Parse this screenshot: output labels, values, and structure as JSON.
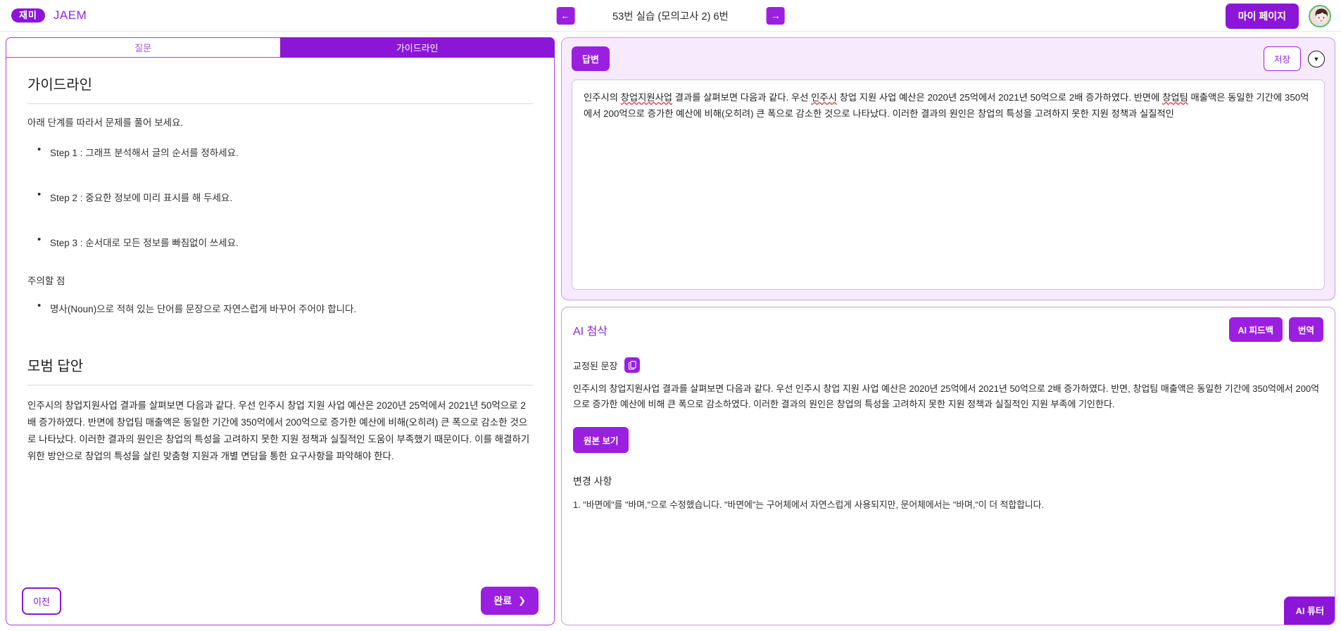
{
  "topbar": {
    "logo_text": "재미",
    "brand": "JAEM",
    "prev_icon": "arrow-left-icon",
    "next_icon": "arrow-right-icon",
    "title": "53번 실습 (모의고사 2) 6번",
    "mypage_label": "마이 페이지"
  },
  "tabs": [
    {
      "label": "질문",
      "active": false
    },
    {
      "label": "가이드라인",
      "active": true
    }
  ],
  "guideline": {
    "heading": "가이드라인",
    "intro": "아래 단계를 따라서 문제를 풀어 보세요.",
    "steps": [
      "Step 1 : 그래프 분석해서 글의 순서를 정하세요.",
      "Step 2 : 중요한 정보에 미리 표시를 해 두세요.",
      "Step 3 : 순서대로 모든 정보를 빠짐없이 쓰세요."
    ],
    "caution_title": "주의할 점",
    "caution_items": [
      "명사(Noun)으로 적혀 있는 단어를 문장으로 자연스럽게 바꾸어 주어야 합니다."
    ],
    "model_answer_heading": "모범 답안",
    "model_answer_text": "인주시의 창업지원사업 결과를 살펴보면 다음과 같다. 우선 인주시 창업 지원 사업 예산은 2020년 25억에서 2021년 50억으로 2배 증가하였다. 반면에 창업팀 매출액은 동일한 기간에 350억에서 200억으로 증가한 예산에 비해(오히려) 큰 폭으로 감소한 것으로 나타났다. 이러한 결과의 원인은 창업의 특성을 고려하지 못한 지원 정책과 실질적인 도움이 부족했기 때문이다. 이를 해결하기 위한 방안으로 창업의 특성을 살린 맞춤형 지원과 개별 면담을 통한 요구사항을 파악해야 한다."
  },
  "footer": {
    "prev_label": "이전",
    "done_label": "완료",
    "done_chevron": "chevron-right-icon"
  },
  "answer": {
    "badge_label": "답변",
    "save_label": "저장",
    "collapse_icon": "chevron-down-icon",
    "text_part1": "인주시의 ",
    "text_sp1": "창업지원사업",
    "text_part2": " 결과를 살펴보면 다음과 같다. 우선 ",
    "text_sp2": "인주시",
    "text_part3": " 창업 지원 사업 예산은 2020년 25억에서 2021년 50억으로 2배 증가하였다. 반면에 ",
    "text_sp3": "창업팀",
    "text_part4": " 매출액은 동일한 기간에 350억에서 200억으로 증가한 예산에 비해(오히려) 큰 폭으로 감소한 것으로 나타났다. 이러한 결과의 원인은 창업의 특성을 고려하지 못한 지원 정책과 실질적인"
  },
  "ai": {
    "title": "AI 첨삭",
    "feedback_label": "AI 피드백",
    "translate_label": "번역",
    "corrected_label": "교정된 문장",
    "copy_icon": "copy-icon",
    "corrected_text": "인주시의 창업지원사업 결과를 살펴보면 다음과 같다. 우선 인주시 창업 지원 사업 예산은 2020년 25억에서 2021년 50억으로 2배 증가하였다. 반면, 창업팀 매출액은 동일한 기간에 350억에서 200억으로 증가한 예산에 비해 큰 폭으로 감소하였다. 이러한 결과의 원인은 창업의 특성을 고려하지 못한 지원 정책과 실질적인 지원 부족에 기인한다.",
    "original_label": "원본 보기",
    "changes_title": "변경 사항",
    "changes": [
      "1. \"바면에\"를 \"바며,\"으로 수정했습니다. \"바면에\"는 구어체에서 자연스럽게 사용되지만, 문어체에서는 \"바며,\"이 더 적합합니다."
    ],
    "tutor_label": "AI 튜터"
  },
  "colors": {
    "brand_purple": "#8b16d8",
    "accent_purple": "#9b1fe0",
    "panel_tint": "#f6eafc",
    "border_purple": "#c89ce8",
    "avatar_ring": "#54c06a"
  }
}
